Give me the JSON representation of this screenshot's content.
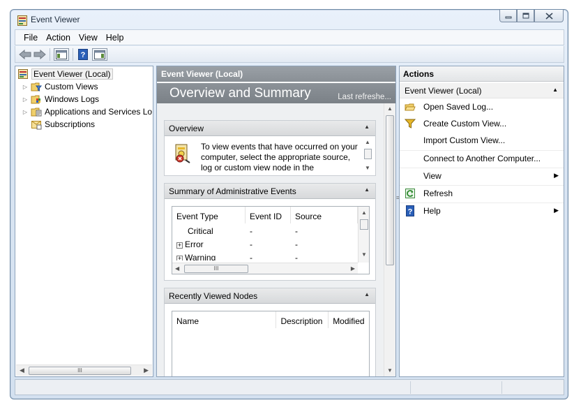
{
  "window": {
    "title": "Event Viewer"
  },
  "menu": {
    "items": [
      "File",
      "Action",
      "View",
      "Help"
    ]
  },
  "tree": {
    "root": "Event Viewer (Local)",
    "items": [
      "Custom Views",
      "Windows Logs",
      "Applications and Services Lo",
      "Subscriptions"
    ]
  },
  "middle": {
    "header": "Event Viewer (Local)",
    "banner_title": "Overview and Summary",
    "last_refresh": "Last refreshe...",
    "overview": {
      "title": "Overview",
      "text": "To view events that have occurred on your computer, select the appropriate source, log or custom view node in the"
    },
    "summary": {
      "title": "Summary of Administrative Events",
      "columns": [
        "Event Type",
        "Event ID",
        "Source"
      ],
      "rows": [
        {
          "type": "Critical",
          "id": "-",
          "source": "-",
          "expandable": false
        },
        {
          "type": "Error",
          "id": "-",
          "source": "-",
          "expandable": true
        },
        {
          "type": "Warning",
          "id": "-",
          "source": "-",
          "expandable": true
        }
      ]
    },
    "recent": {
      "title": "Recently Viewed Nodes",
      "columns": [
        "Name",
        "Description",
        "Modified"
      ]
    }
  },
  "actions": {
    "header": "Actions",
    "group": "Event Viewer (Local)",
    "items": [
      {
        "label": "Open Saved Log...",
        "icon": "folder-open-icon",
        "submenu": false
      },
      {
        "label": "Create Custom View...",
        "icon": "filter-icon",
        "submenu": false
      },
      {
        "label": "Import Custom View...",
        "icon": "",
        "submenu": false
      },
      {
        "label": "Connect to Another Computer...",
        "icon": "",
        "submenu": false
      },
      {
        "label": "View",
        "icon": "",
        "submenu": true
      },
      {
        "label": "Refresh",
        "icon": "refresh-icon",
        "submenu": false
      },
      {
        "label": "Help",
        "icon": "help-icon",
        "submenu": true
      }
    ]
  },
  "scroll_glyph": "III",
  "colors": {
    "pane_header": "#8a9096",
    "banner": "#7b8187",
    "frame": "#d4e1f0"
  }
}
